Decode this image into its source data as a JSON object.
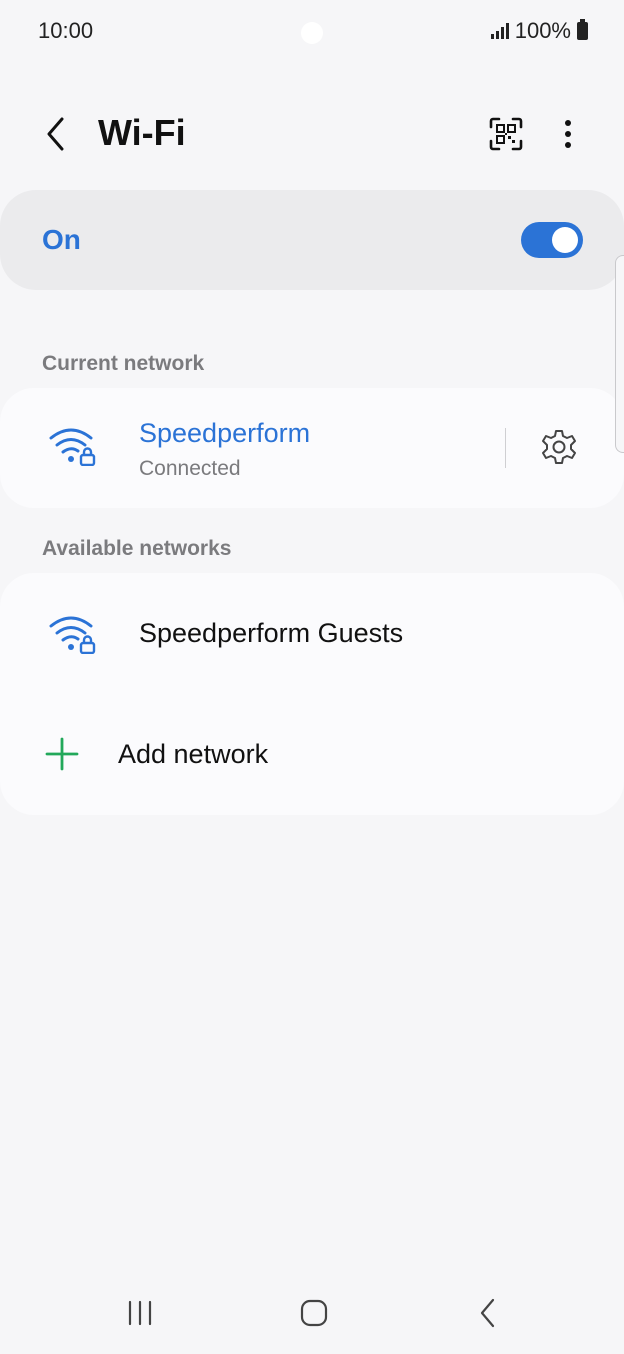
{
  "status_bar": {
    "time": "10:00",
    "battery_text": "100%",
    "icons": [
      "signal-icon",
      "battery-icon"
    ]
  },
  "header": {
    "title": "Wi-Fi",
    "icons": [
      "back-arrow-icon",
      "qr-code-icon",
      "more-options-icon"
    ]
  },
  "wifi_toggle": {
    "label": "On",
    "state": "on",
    "accent_color": "#2b73d6"
  },
  "current_network": {
    "section_label": "Current network",
    "name": "Speedperform",
    "status": "Connected",
    "icons": [
      "wifi-lock-icon",
      "gear-icon"
    ]
  },
  "available_networks": {
    "section_label": "Available networks",
    "items": [
      {
        "name": "Speedperform Guests",
        "icon": "wifi-lock-icon"
      }
    ],
    "add_network_label": "Add network",
    "add_icon_color": "#22a85a"
  },
  "nav_bar": {
    "icons": [
      "recent-apps-icon",
      "home-icon",
      "back-icon"
    ]
  }
}
